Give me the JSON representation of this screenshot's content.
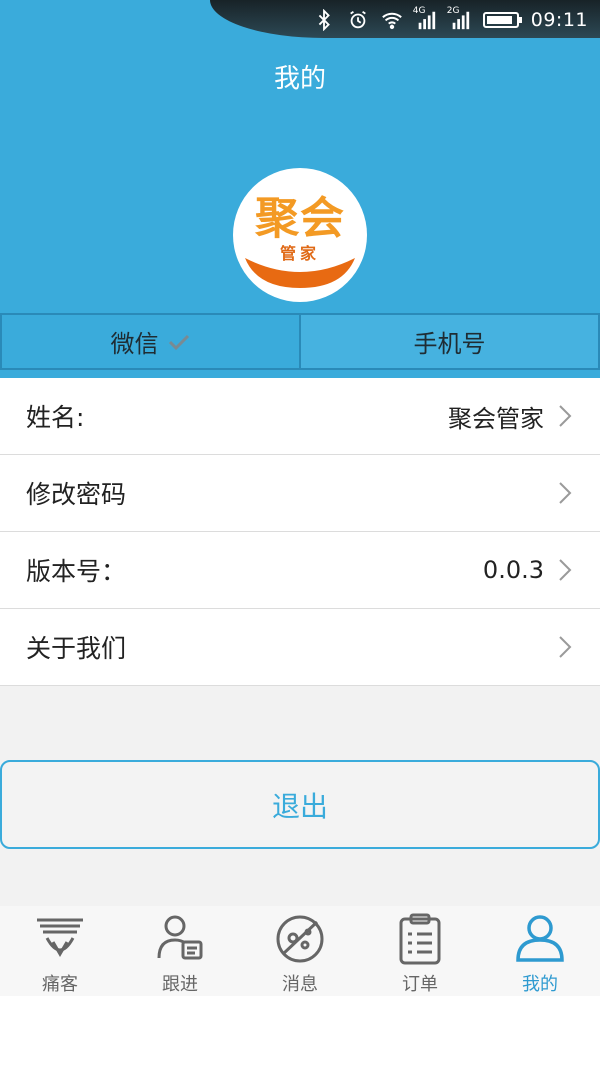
{
  "status_bar": {
    "signal_1_label": "4G",
    "signal_2_label": "2G",
    "time": "09:11",
    "battery_level": 0.9,
    "icons": [
      "bluetooth-icon",
      "alarm-icon",
      "wifi-icon",
      "signal-icon",
      "signal-icon",
      "battery-icon"
    ]
  },
  "header": {
    "title": "我的",
    "logo": {
      "main_text": "聚会",
      "sub_text": "管家"
    }
  },
  "login_tabs": [
    {
      "label": "微信",
      "checked": true
    },
    {
      "label": "手机号",
      "checked": false
    }
  ],
  "settings": [
    {
      "label": "姓名:",
      "value": "聚会管家"
    },
    {
      "label": "修改密码",
      "value": ""
    },
    {
      "label": "版本号：",
      "value": "0.0.3"
    },
    {
      "label": "关于我们",
      "value": ""
    }
  ],
  "logout_label": "退出",
  "bottom_nav": [
    {
      "label": "痛客",
      "icon": "shield-icon",
      "active": false
    },
    {
      "label": "跟进",
      "icon": "user-card-icon",
      "active": false
    },
    {
      "label": "消息",
      "icon": "planet-icon",
      "active": false
    },
    {
      "label": "订单",
      "icon": "clipboard-icon",
      "active": false
    },
    {
      "label": "我的",
      "icon": "person-icon",
      "active": true
    }
  ],
  "colors": {
    "primary": "#3aabdb",
    "logo_orange": "#f39a24",
    "active_tab": "#2e9ad0"
  }
}
